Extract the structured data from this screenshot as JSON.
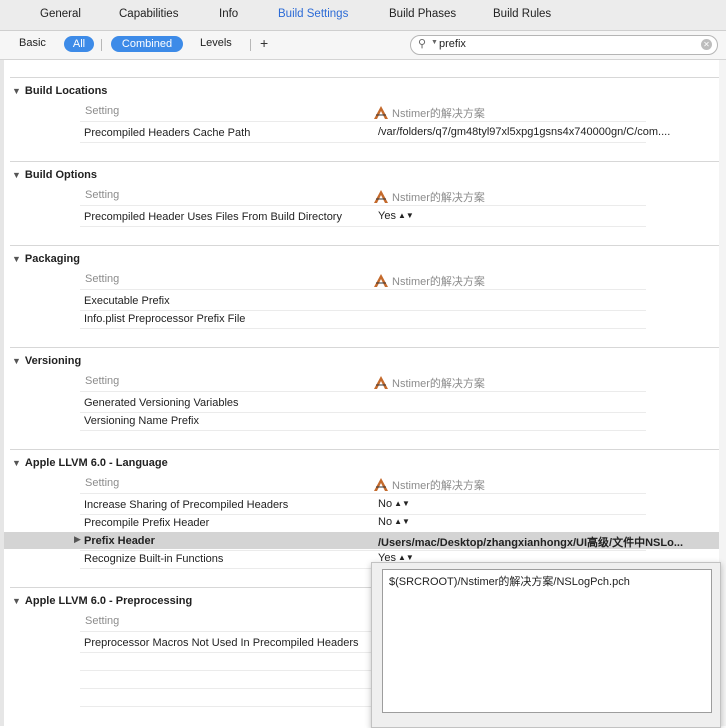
{
  "tabs": [
    {
      "label": "General"
    },
    {
      "label": "Capabilities"
    },
    {
      "label": "Info"
    },
    {
      "label": "Build Settings",
      "active": true
    },
    {
      "label": "Build Phases"
    },
    {
      "label": "Build Rules"
    }
  ],
  "filter": {
    "basic": "Basic",
    "all": "All",
    "combined": "Combined",
    "levels": "Levels",
    "add": "+"
  },
  "search": {
    "value": "prefix"
  },
  "columns": {
    "setting": "Setting",
    "project": "Nstimer的解决方案"
  },
  "sections": [
    {
      "title": "Build Locations",
      "rows": [
        {
          "label": "Precompiled Headers Cache Path",
          "value": "/var/folders/q7/gm48tyl97xl5xpg1gsns4x740000gn/C/com...."
        }
      ]
    },
    {
      "title": "Build Options",
      "rows": [
        {
          "label": "Precompiled Header Uses Files From Build Directory",
          "value": "Yes"
        }
      ]
    },
    {
      "title": "Packaging",
      "rows": [
        {
          "label": "Executable Prefix",
          "value": ""
        },
        {
          "label": "Info.plist Preprocessor Prefix File",
          "value": ""
        }
      ]
    },
    {
      "title": "Versioning",
      "rows": [
        {
          "label": "Generated Versioning Variables",
          "value": ""
        },
        {
          "label": "Versioning Name Prefix",
          "value": ""
        }
      ]
    },
    {
      "title": "Apple LLVM 6.0 - Language",
      "rows": [
        {
          "label": "Increase Sharing of Precompiled Headers",
          "value": "No"
        },
        {
          "label": "Precompile Prefix Header",
          "value": "No"
        },
        {
          "label": "Prefix Header",
          "value": "/Users/mac/Desktop/zhangxianhongx/UI高级/文件中NSLo..."
        },
        {
          "label": "Recognize Built-in Functions",
          "value": "Yes"
        }
      ]
    },
    {
      "title": "Apple LLVM 6.0 - Preprocessing",
      "rows": [
        {
          "label": "Preprocessor Macros Not Used In Precompiled Headers",
          "value": ""
        }
      ]
    }
  ],
  "popup": {
    "value": "$(SRCROOT)/Nstimer的解决方案/NSLogPch.pch"
  },
  "colors": {
    "accent": "#3d8be8",
    "selected_row": "#d4d4d4",
    "tab_active": "#2c6bd6"
  }
}
